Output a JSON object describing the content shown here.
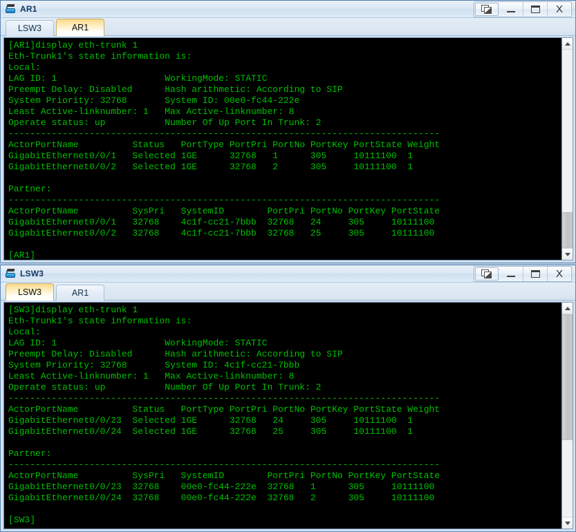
{
  "desktop": {
    "background_color": "#b9cfe4"
  },
  "windows": [
    {
      "id": "ar1",
      "title": "AR1",
      "icon": "device-icon",
      "controls": {
        "cascade_label": "",
        "minimize_label": "",
        "maximize_label": "",
        "close_label": "X"
      },
      "tabs": [
        {
          "label": "LSW3",
          "active": false
        },
        {
          "label": "AR1",
          "active": true
        }
      ],
      "terminal": {
        "prompt": "[AR1]",
        "text": "[AR1]display eth-trunk 1\nEth-Trunk1's state information is:\nLocal:\nLAG ID: 1                    WorkingMode: STATIC\nPreempt Delay: Disabled      Hash arithmetic: According to SIP\nSystem Priority: 32768       System ID: 00e0-fc44-222e\nLeast Active-linknumber: 1   Max Active-linknumber: 8\nOperate status: up           Number Of Up Port In Trunk: 2\n--------------------------------------------------------------------------------\nActorPortName          Status   PortType PortPri PortNo PortKey PortState Weight\nGigabitEthernet0/0/1   Selected 1GE      32768   1      305     10111100  1\nGigabitEthernet0/0/2   Selected 1GE      32768   2      305     10111100  1\n\nPartner:\n--------------------------------------------------------------------------------\nActorPortName          SysPri   SystemID        PortPri PortNo PortKey PortState\nGigabitEthernet0/0/1   32768    4c1f-cc21-7bbb  32768   24     305     10111100\nGigabitEthernet0/0/2   32768    4c1f-cc21-7bbb  32768   25     305     10111100\n\n[AR1]",
        "fg_color": "#00c000",
        "bg_color": "#000000"
      },
      "scrollbar": {
        "up_arrow": "scroll-up-arrow",
        "down_arrow": "scroll-down-arrow",
        "thumb_top_pct": 82,
        "thumb_height_pct": 18
      }
    },
    {
      "id": "lsw3",
      "title": "LSW3",
      "icon": "device-icon",
      "controls": {
        "cascade_label": "",
        "minimize_label": "",
        "maximize_label": "",
        "close_label": "X"
      },
      "tabs": [
        {
          "label": "LSW3",
          "active": true
        },
        {
          "label": "AR1",
          "active": false
        }
      ],
      "terminal": {
        "prompt": "[SW3]",
        "text": "[SW3]display eth-trunk 1\nEth-Trunk1's state information is:\nLocal:\nLAG ID: 1                    WorkingMode: STATIC\nPreempt Delay: Disabled      Hash arithmetic: According to SIP\nSystem Priority: 32768       System ID: 4c1f-cc21-7bbb\nLeast Active-linknumber: 1   Max Active-linknumber: 8\nOperate status: up           Number Of Up Port In Trunk: 2\n--------------------------------------------------------------------------------\nActorPortName          Status   PortType PortPri PortNo PortKey PortState Weight\nGigabitEthernet0/0/23  Selected 1GE      32768   24     305     10111100  1\nGigabitEthernet0/0/24  Selected 1GE      32768   25     305     10111100  1\n\nPartner:\n--------------------------------------------------------------------------------\nActorPortName          SysPri   SystemID        PortPri PortNo PortKey PortState\nGigabitEthernet0/0/23  32768    00e0-fc44-222e  32768   1      305     10111100\nGigabitEthernet0/0/24  32768    00e0-fc44-222e  32768   2      305     10111100\n\n[SW3]",
        "fg_color": "#00c000",
        "bg_color": "#000000"
      },
      "scrollbar": {
        "up_arrow": "scroll-up-arrow",
        "down_arrow": "scroll-down-arrow",
        "thumb_top_pct": 0,
        "thumb_height_pct": 62
      }
    }
  ]
}
